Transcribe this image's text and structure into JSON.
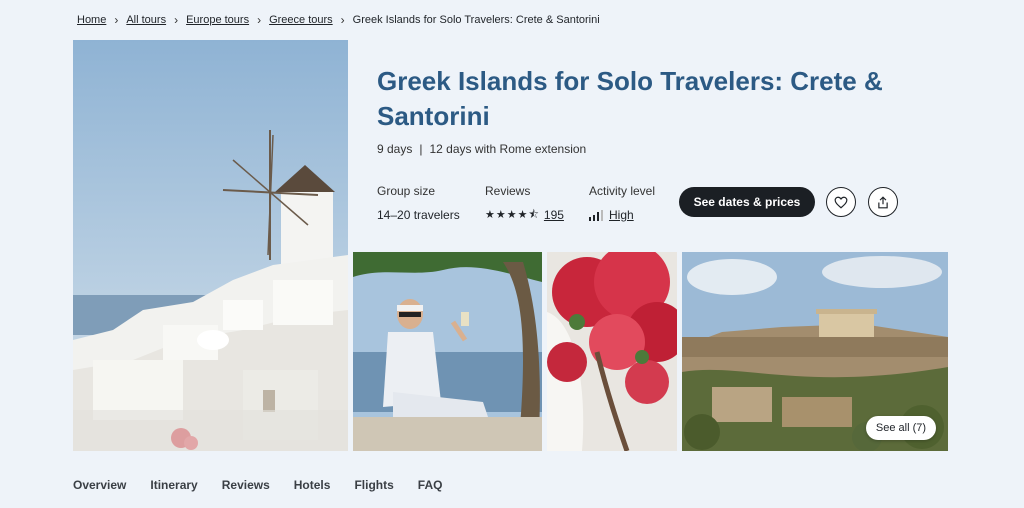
{
  "breadcrumb": {
    "items": [
      "Home",
      "All tours",
      "Europe tours",
      "Greece tours"
    ],
    "current": "Greek Islands for Solo Travelers: Crete & Santorini"
  },
  "tour": {
    "title": "Greek Islands for Solo Travelers: Crete & Santorini",
    "duration": "9 days",
    "extension": "12 days with Rome extension"
  },
  "stats": {
    "group_label": "Group size",
    "group_value": "14–20 travelers",
    "reviews_label": "Reviews",
    "reviews_count": "195",
    "rating": 4.5,
    "activity_label": "Activity level",
    "activity_value": "High"
  },
  "actions": {
    "cta_label": "See dates & prices",
    "favorite_icon": "heart-icon",
    "share_icon": "share-icon"
  },
  "gallery": {
    "see_all_label": "See all (7)"
  },
  "tabs": [
    "Overview",
    "Itinerary",
    "Reviews",
    "Hotels",
    "Flights",
    "FAQ"
  ],
  "colors": {
    "background": "#eef3f9",
    "title": "#2c5a84",
    "cta_bg": "#1b1f24"
  }
}
